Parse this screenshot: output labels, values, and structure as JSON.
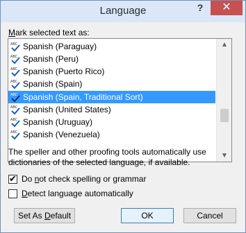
{
  "window": {
    "title": "Language",
    "help_label": "?",
    "close_label": "✕"
  },
  "mark_label": {
    "accel": "M",
    "rest": "ark selected text as:"
  },
  "languages": [
    {
      "label": "Spanish (Paraguay)",
      "selected": false
    },
    {
      "label": "Spanish (Peru)",
      "selected": false
    },
    {
      "label": "Spanish (Puerto Rico)",
      "selected": false
    },
    {
      "label": "Spanish (Spain)",
      "selected": false
    },
    {
      "label": "Spanish (Spain, Traditional Sort)",
      "selected": true
    },
    {
      "label": "Spanish (United States)",
      "selected": false
    },
    {
      "label": "Spanish (Uruguay)",
      "selected": false
    },
    {
      "label": "Spanish (Venezuela)",
      "selected": false
    }
  ],
  "proofing_icon_text": "ABC",
  "description": "The speller and other proofing tools automatically use dictionaries of the selected language, if available.",
  "options": {
    "no_check": {
      "checked": true,
      "pre": "Do ",
      "accel": "n",
      "post": "ot check spelling or grammar"
    },
    "detect": {
      "checked": false,
      "pre": "",
      "accel": "D",
      "post": "etect language automatically"
    }
  },
  "buttons": {
    "set_default": {
      "pre": "Set As ",
      "accel": "D",
      "post": "efault"
    },
    "ok": "OK",
    "cancel": "Cancel"
  },
  "colors": {
    "titlebar": "#d9e7f8",
    "close": "#c75050",
    "selection": "#3399ff"
  }
}
